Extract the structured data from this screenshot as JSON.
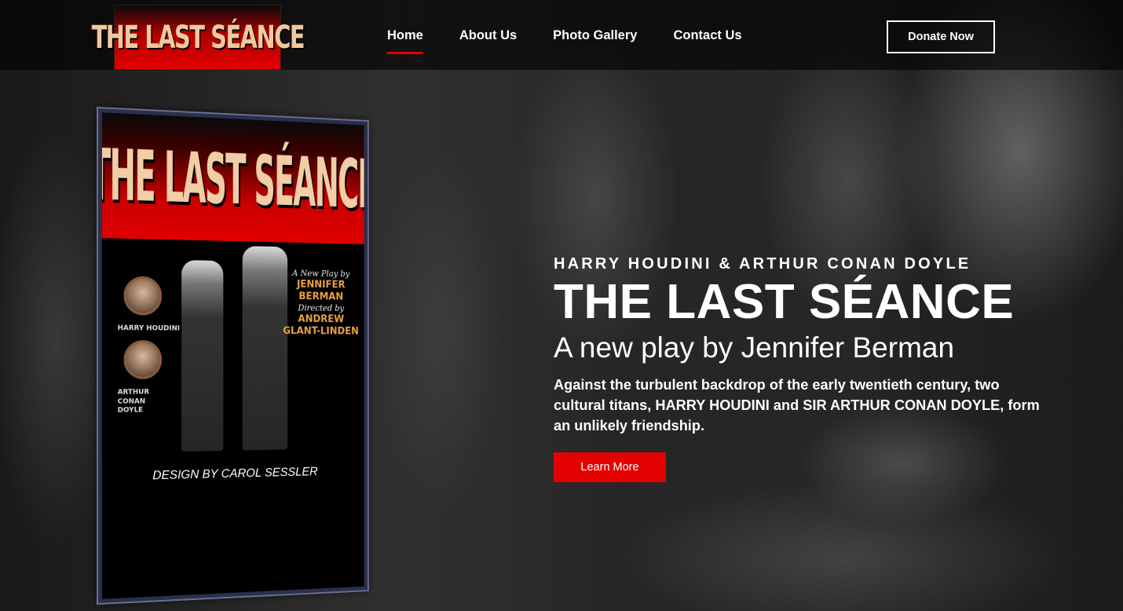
{
  "site": {
    "logo_text": "THE LAST SÉANCE"
  },
  "nav": {
    "items": [
      {
        "label": "Home",
        "active": true
      },
      {
        "label": "About Us",
        "active": false
      },
      {
        "label": "Photo Gallery",
        "active": false
      },
      {
        "label": "Contact Us",
        "active": false
      }
    ],
    "donate_label": "Donate Now"
  },
  "poster": {
    "title": "THE LAST SÉANCE",
    "portrait_1_label": "HARRY HOUDINI",
    "portrait_2_label": "ARTHUR CONAN DOYLE",
    "credit_line_1": "A New Play by",
    "credit_name_1": "JENNIFER BERMAN",
    "credit_line_2": "Directed by",
    "credit_name_2": "ANDREW GLANT-LINDEN",
    "design_credit": "DESIGN BY CAROL SESSLER"
  },
  "hero": {
    "eyebrow": "HARRY HOUDINI & ARTHUR CONAN DOYLE",
    "title": "THE LAST SÉANCE",
    "subtitle": "A new play by Jennifer Berman",
    "description": "Against the turbulent backdrop of the early twentieth century, two cultural titans, HARRY HOUDINI and SIR ARTHUR CONAN DOYLE, form an unlikely friendship.",
    "cta_label": "Learn More"
  },
  "colors": {
    "accent": "#e30000",
    "header_bg": "#000000",
    "text": "#ffffff"
  }
}
